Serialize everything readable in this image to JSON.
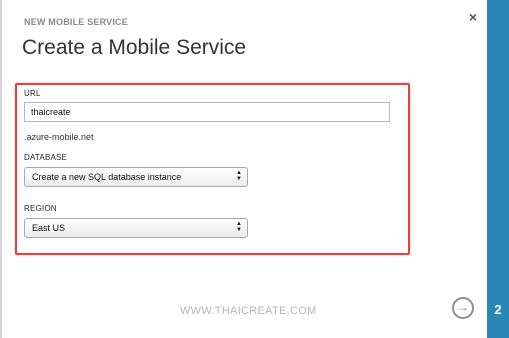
{
  "dialog": {
    "eyebrow": "NEW MOBILE SERVICE",
    "title": "Create a Mobile Service",
    "close_icon": "×"
  },
  "form": {
    "url_label": "URL",
    "url_value": "thaicreate",
    "url_suffix": ".azure-mobile.net",
    "database_label": "DATABASE",
    "database_selected": "Create a new SQL database instance",
    "region_label": "REGION",
    "region_selected": "East US"
  },
  "footer": {
    "watermark": "WWW.THAICREATE.COM",
    "next_icon": "→",
    "step_number": "2"
  },
  "colors": {
    "highlight_border": "#e8423d",
    "side_panel": "#2a86b5"
  }
}
